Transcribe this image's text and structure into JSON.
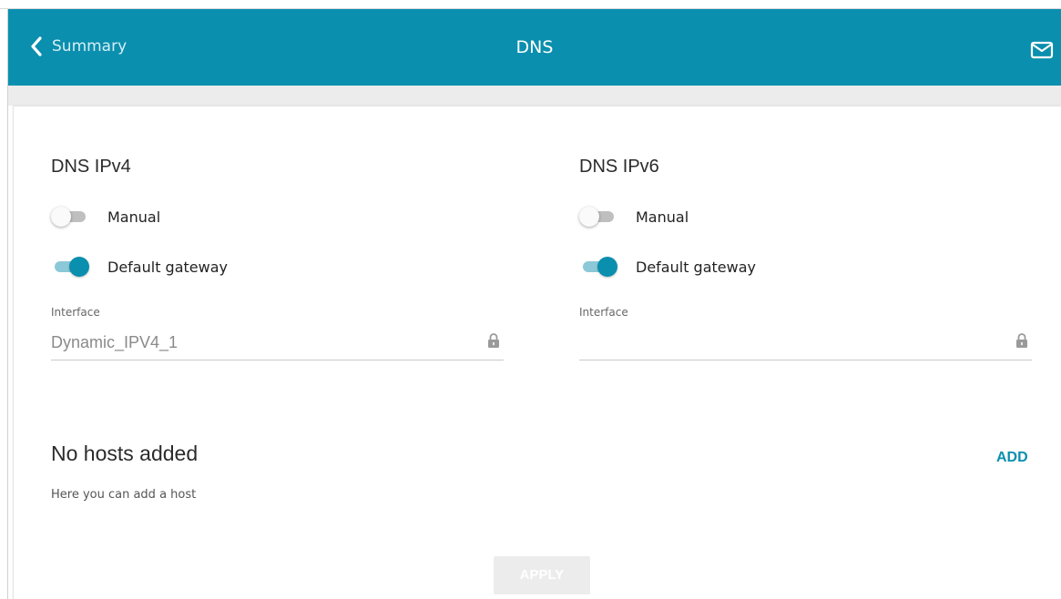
{
  "header": {
    "back_label": "Summary",
    "title": "DNS",
    "icons": {
      "back": "chevron-left-icon",
      "mail": "mail-icon"
    }
  },
  "dns_ipv4": {
    "title": "DNS IPv4",
    "manual": {
      "label": "Manual",
      "enabled": false
    },
    "default_gateway": {
      "label": "Default gateway",
      "enabled": true
    },
    "interface": {
      "label": "Interface",
      "value": "Dynamic_IPV4_1",
      "locked": true
    }
  },
  "dns_ipv6": {
    "title": "DNS IPv6",
    "manual": {
      "label": "Manual",
      "enabled": false
    },
    "default_gateway": {
      "label": "Default gateway",
      "enabled": true
    },
    "interface": {
      "label": "Interface",
      "value": "",
      "locked": true
    }
  },
  "hosts": {
    "title": "No hosts added",
    "description": "Here you can add a host",
    "add_label": "ADD"
  },
  "apply_label": "APPLY",
  "colors": {
    "header": "#0a8fae",
    "accent": "#0a8fae",
    "toggle_on_track": "#8cc8d8",
    "toggle_off_track": "#bfbfbf",
    "apply_disabled": "#ececec"
  }
}
